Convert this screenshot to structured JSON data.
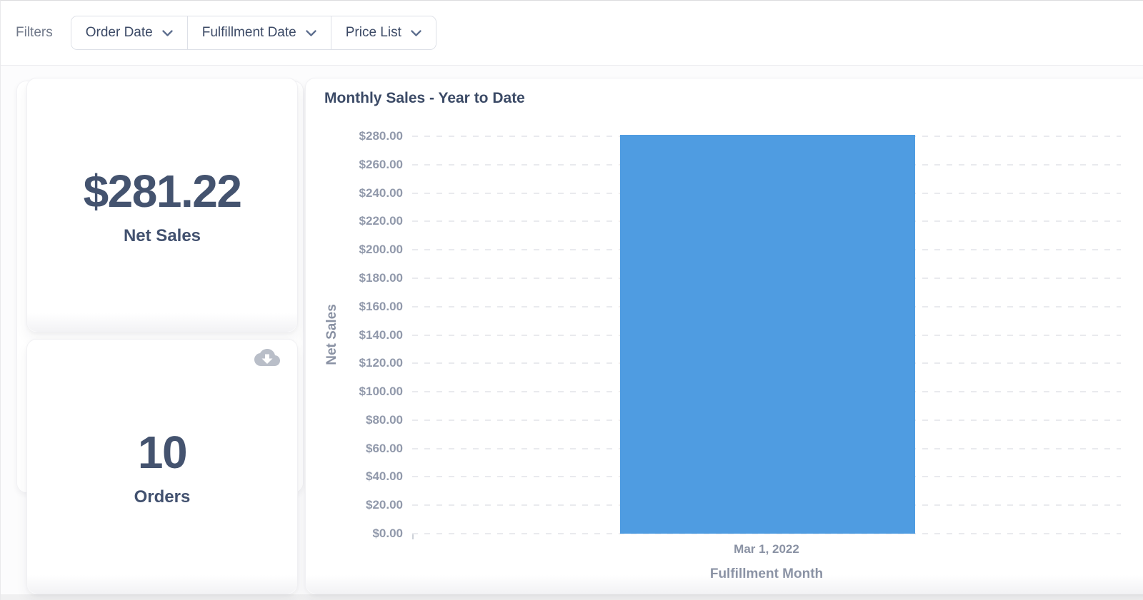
{
  "filters_bar": {
    "label": "Filters",
    "dropdowns": [
      {
        "id": "order-date",
        "label": "Order Date"
      },
      {
        "id": "fulfillment-date",
        "label": "Fulfillment Date"
      },
      {
        "id": "price-list",
        "label": "Price List"
      }
    ]
  },
  "kpi_cards": [
    {
      "id": "net-sales",
      "value": "$281.22",
      "label": "Net Sales"
    },
    {
      "id": "orders",
      "value": "10",
      "label": "Orders"
    }
  ],
  "chart_data": {
    "type": "bar",
    "title": "Monthly Sales - Year to Date",
    "categories": [
      "Mar 1, 2022"
    ],
    "values": [
      281.22
    ],
    "xlabel": "Fulfillment Month",
    "ylabel": "Net Sales",
    "ylim": [
      0,
      280
    ],
    "ytick_step": 20,
    "ytick_labels": [
      "$280.00",
      "$260.00",
      "$240.00",
      "$220.00",
      "$200.00",
      "$180.00",
      "$160.00",
      "$140.00",
      "$120.00",
      "$100.00",
      "$80.00",
      "$60.00",
      "$40.00",
      "$20.00",
      "$0.00"
    ],
    "grid": "horizontal-dashed",
    "legend": "none",
    "bar_color": "#4f9ce1"
  },
  "icons": {
    "dropdown_chevron": "chevron-down",
    "card_download": "cloud-download"
  },
  "colors": {
    "accent_blue": "#4f9ce1",
    "navy_text": "#44536f",
    "axis_text": "#9199ab",
    "axis_title_text": "#8a92a4",
    "muted_gray": "#71798a",
    "border": "#dde0e7",
    "icon_gray": "#b9bec8"
  }
}
